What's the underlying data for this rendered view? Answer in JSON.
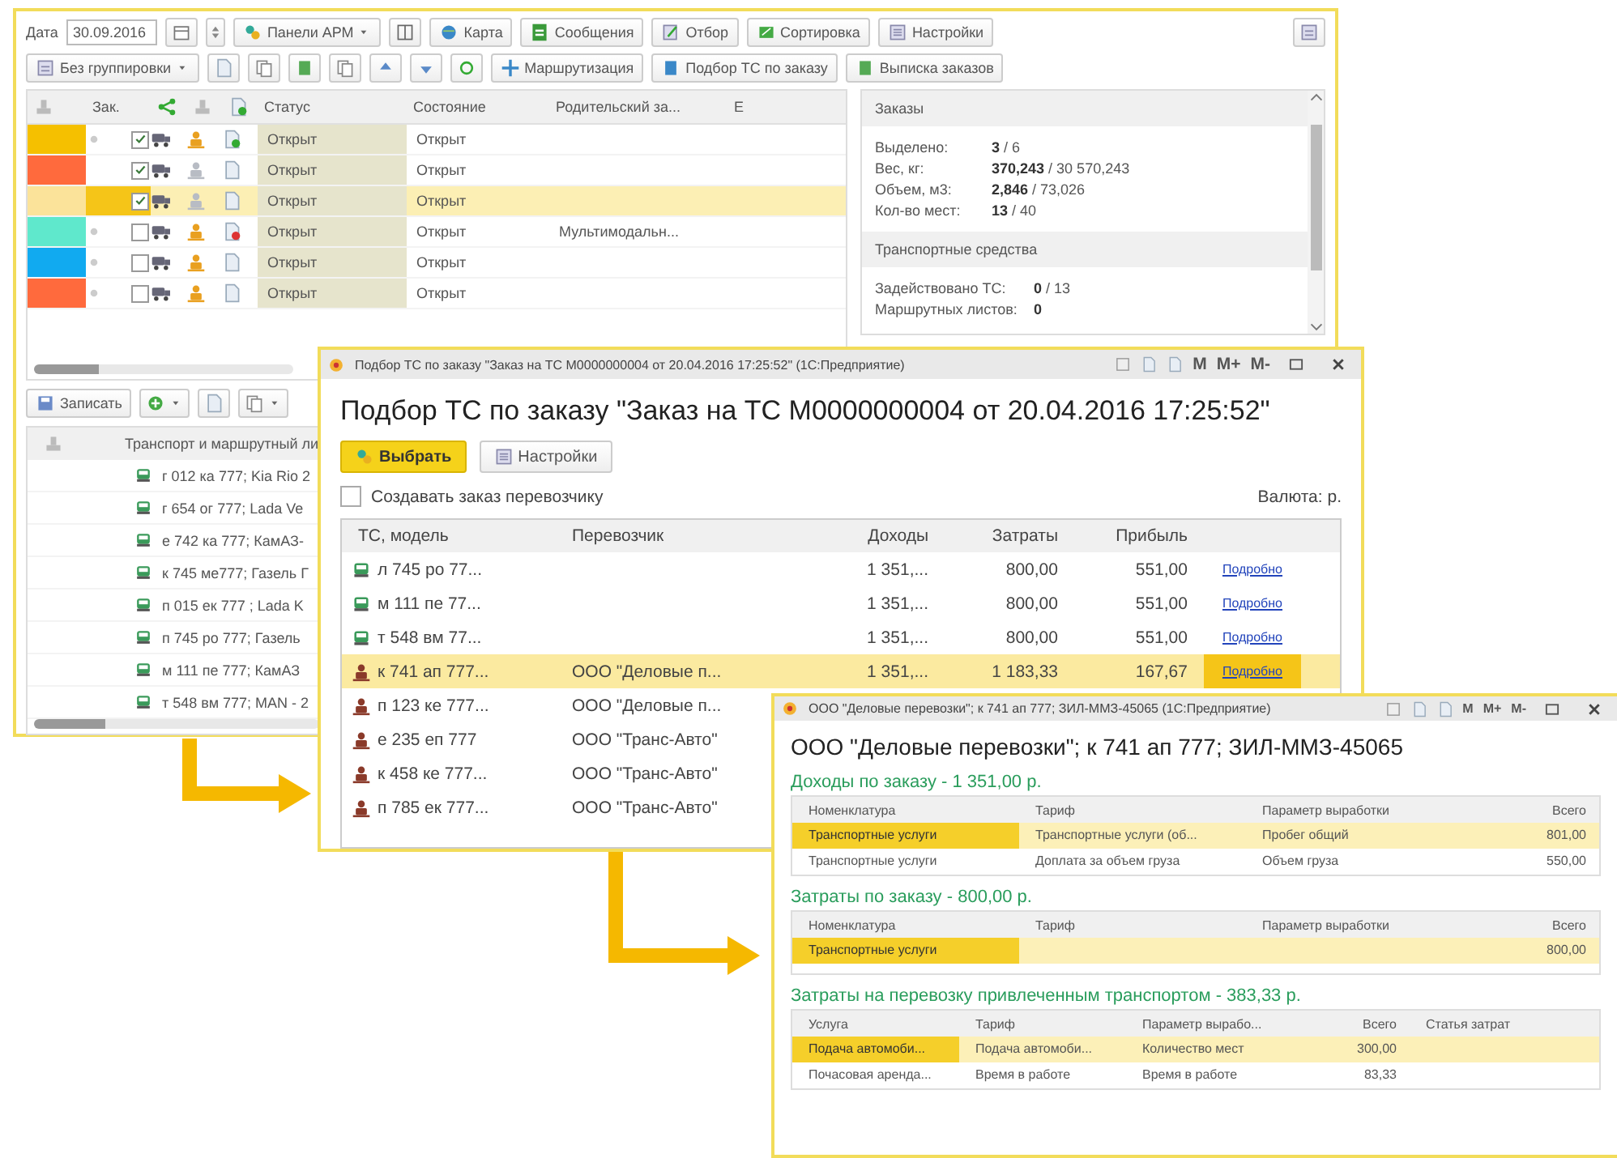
{
  "main_window": {
    "toolbar_top": {
      "date_label": "Дата",
      "date_value": "30.09.2016",
      "items": [
        {
          "kind": "text",
          "label": "Панели АРМ",
          "dropdown": true
        },
        {
          "kind": "icon"
        },
        {
          "kind": "text",
          "label": "Карта",
          "dropdown": false
        },
        {
          "kind": "text",
          "label": "Сообщения",
          "dropdown": false
        },
        {
          "kind": "text",
          "label": "Отбор",
          "dropdown": false
        },
        {
          "kind": "text",
          "label": "Сортировка",
          "dropdown": false
        },
        {
          "kind": "text",
          "label": "Настройки",
          "dropdown": false
        }
      ]
    },
    "toolbar_second": [
      {
        "kind": "text",
        "label": "Без группировки",
        "dropdown": true
      },
      {
        "kind": "icon"
      },
      {
        "kind": "icon"
      },
      {
        "kind": "icon"
      },
      {
        "kind": "icon"
      },
      {
        "kind": "icon"
      },
      {
        "kind": "icon"
      },
      {
        "kind": "icon"
      },
      {
        "kind": "text",
        "label": "Маршрутизация",
        "dropdown": false
      },
      {
        "kind": "text",
        "label": "Подбор ТС по заказу",
        "dropdown": false
      },
      {
        "kind": "text",
        "label": "Выписка заказов",
        "dropdown": false
      }
    ],
    "orders_table": {
      "columns": [
        "Зак.",
        "Статус",
        "Состояние",
        "Родительский за...",
        "Е"
      ],
      "rows": [
        {
          "color": "#f5c000",
          "expandable": true,
          "checked": true,
          "selected": false,
          "driver_assigned": true,
          "doc_ok": true,
          "doc_error": false,
          "status": "Открыт",
          "state": "Открыт",
          "parent": ""
        },
        {
          "color": "#ff6a3d",
          "expandable": false,
          "checked": true,
          "selected": false,
          "driver_assigned": false,
          "doc_ok": false,
          "doc_error": false,
          "status": "Открыт",
          "state": "Открыт",
          "parent": ""
        },
        {
          "color": "#fbe39a",
          "expandable": false,
          "checked": true,
          "selected": true,
          "driver_assigned": false,
          "doc_ok": false,
          "doc_error": false,
          "status": "Открыт",
          "state": "Открыт",
          "parent": ""
        },
        {
          "color": "#5fe8cc",
          "expandable": true,
          "checked": false,
          "selected": false,
          "driver_assigned": true,
          "doc_ok": false,
          "doc_error": true,
          "status": "Открыт",
          "state": "Открыт",
          "parent": "Мультимодальн..."
        },
        {
          "color": "#11aaf0",
          "expandable": true,
          "checked": false,
          "selected": false,
          "driver_assigned": true,
          "doc_ok": false,
          "doc_error": false,
          "status": "Открыт",
          "state": "Открыт",
          "parent": ""
        },
        {
          "color": "#ff6a3d",
          "expandable": true,
          "checked": false,
          "selected": false,
          "driver_assigned": true,
          "doc_ok": false,
          "doc_error": false,
          "status": "Открыт",
          "state": "Открыт",
          "parent": ""
        }
      ]
    },
    "summary_panel": [
      {
        "title": "Заказы",
        "rows": [
          {
            "label": "Выделено:",
            "value": "3",
            "total": "/ 6"
          },
          {
            "label": "Вес, кг:",
            "value": "370,243",
            "total": "/ 30 570,243"
          },
          {
            "label": "Объем, м3:",
            "value": "2,846",
            "total": "/ 73,026"
          },
          {
            "label": "Кол-во мест:",
            "value": "13",
            "total": "/ 40"
          }
        ]
      },
      {
        "title": "Транспортные средства",
        "rows": [
          {
            "label": "Задействовано ТС:",
            "value": "0",
            "total": "/ 13"
          },
          {
            "label": "Маршрутных листов:",
            "value": "0",
            "total": ""
          }
        ]
      }
    ],
    "bottom_toolbar": {
      "save_label": "Записать"
    },
    "transport_table": {
      "header": "Транспорт и маршрутный ли",
      "rows": [
        "г 012 ка 777; Kia Rio 2",
        "г 654 ог 777; Lada Ve",
        "е 742 ка 777; КамАЗ-",
        "к 745 ме777; Газель Г",
        "п 015 ек 777 ; Lada K",
        "п 745 ро 777; Газель",
        "м 111 пе 777; КамАЗ",
        "т 548 вм 777; MAN - 2"
      ]
    }
  },
  "selection_window": {
    "title": "Подбор ТС по заказу \"Заказ на ТС М0000000004 от 20.04.2016 17:25:52\" (1С:Предприятие)",
    "memory_buttons": [
      "M",
      "M+",
      "M-"
    ],
    "heading": "Подбор ТС по заказу \"Заказ на ТС М0000000004 от 20.04.2016 17:25:52\"",
    "buttons": [
      {
        "label": "Выбрать",
        "default": true
      },
      {
        "label": "Настройки",
        "default": false
      }
    ],
    "create_order": {
      "label": "Создавать заказ перевозчику",
      "checked": false
    },
    "currency": "Валюта: р.",
    "columns": [
      "ТС, модель",
      "Перевозчик",
      "Доходы",
      "Затраты",
      "Прибыль"
    ],
    "rows": [
      {
        "kind": "own",
        "selected": false,
        "vehicle": "л 745 ро 77...",
        "carrier": "",
        "income": "1 351,...",
        "costs": "800,00",
        "profit": "551,00",
        "link": "Подробно"
      },
      {
        "kind": "own",
        "selected": false,
        "vehicle": "м 111 пе 77...",
        "carrier": "",
        "income": "1 351,...",
        "costs": "800,00",
        "profit": "551,00",
        "link": "Подробно"
      },
      {
        "kind": "own",
        "selected": false,
        "vehicle": "т 548 вм 77...",
        "carrier": "",
        "income": "1 351,...",
        "costs": "800,00",
        "profit": "551,00",
        "link": "Подробно"
      },
      {
        "kind": "hired",
        "selected": true,
        "vehicle": "к 741 ап 777...",
        "carrier": "ООО \"Деловые п...",
        "income": "1 351,...",
        "costs": "1 183,33",
        "profit": "167,67",
        "link": "Подробно"
      },
      {
        "kind": "hired",
        "selected": false,
        "vehicle": "п 123 ке 777...",
        "carrier": "ООО \"Деловые п..."
      },
      {
        "kind": "hired",
        "selected": false,
        "vehicle": "е 235 еп 777",
        "carrier": "ООО \"Транс-Авто\""
      },
      {
        "kind": "hired",
        "selected": false,
        "vehicle": "к 458 ке 777...",
        "carrier": "ООО \"Транс-Авто\""
      },
      {
        "kind": "hired",
        "selected": false,
        "vehicle": "п 785 ек 777...",
        "carrier": "ООО \"Транс-Авто\""
      }
    ]
  },
  "details_window": {
    "title": "ООО \"Деловые перевозки\"; к 741 ап 777; ЗИЛ-ММЗ-45065 (1С:Предприятие)",
    "memory_buttons": [
      "M",
      "M+",
      "M-"
    ],
    "heading": "ООО \"Деловые перевозки\"; к 741 ап 777; ЗИЛ-ММЗ-45065",
    "sections": [
      {
        "title": "Доходы по заказу - 1 351,00 р.",
        "columns": [
          "Номенклатура",
          "Тариф",
          "Параметр выработки",
          "Всего"
        ],
        "rows": [
          {
            "selected": true,
            "cells": [
              "Транспортные услуги",
              "Транспортные услуги (об...",
              "Пробег общий",
              "801,00"
            ]
          },
          {
            "selected": false,
            "cells": [
              "Транспортные услуги",
              "Доплата за объем груза",
              "Объем груза",
              "550,00"
            ]
          }
        ]
      },
      {
        "title": "Затраты по заказу - 800,00 р.",
        "columns": [
          "Номенклатура",
          "Тариф",
          "Параметр выработки",
          "Всего"
        ],
        "rows": [
          {
            "selected": true,
            "cells": [
              "Транспортные услуги",
              "",
              "",
              "800,00"
            ]
          }
        ]
      },
      {
        "title": "Затраты на перевозку привлеченным транспортом - 383,33 р.",
        "columns": [
          "Услуга",
          "Тариф",
          "Параметр вырабо...",
          "Всего",
          "Статья затрат"
        ],
        "rows": [
          {
            "selected": true,
            "cells": [
              "Подача автомоби...",
              "Подача автомоби...",
              "Количество мест",
              "300,00",
              ""
            ]
          },
          {
            "selected": false,
            "cells": [
              "Почасовая аренда...",
              "Время в работе",
              "Время в работе",
              "83,33",
              ""
            ]
          }
        ]
      }
    ]
  }
}
